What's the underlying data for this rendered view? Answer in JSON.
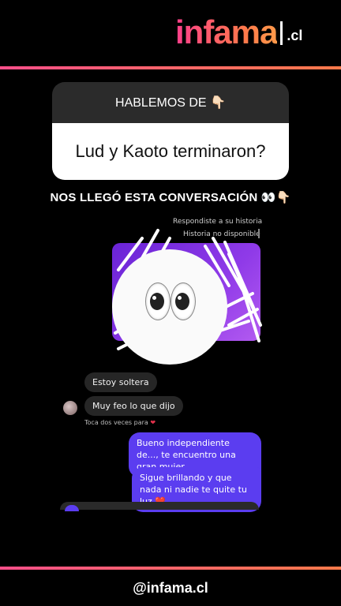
{
  "brand": {
    "name": "infama",
    "tld": ".cl",
    "handle": "@infama.cl"
  },
  "question_card": {
    "header": "HABLEMOS DE 👇🏻",
    "question": "Lud y Kaoto terminaron?"
  },
  "headline": "NOS LLEGÓ ESTA CONVERSACIÓN 👀👇🏻",
  "story_meta": {
    "replied": "Respondiste a su historia",
    "unavailable": "Historia no disponible"
  },
  "messages": {
    "received": [
      "Estoy soltera",
      "Muy feo lo que dijo"
    ],
    "double_tap_hint": "Toca dos veces para",
    "sent": [
      "Bueno independiente de..., te encuentro una gran mujer",
      "Sigue brillando y que nada ni nadie te quite tu luz ❤️"
    ]
  },
  "icons": {
    "eyes_sticker": "eyes-emoji-icon",
    "heart": "heart-icon",
    "avatar": "avatar"
  },
  "colors": {
    "accent_start": "#ff4f8a",
    "accent_end": "#ff7a4a",
    "sent_bubble": "#5b3df0",
    "received_bubble": "#262626"
  }
}
